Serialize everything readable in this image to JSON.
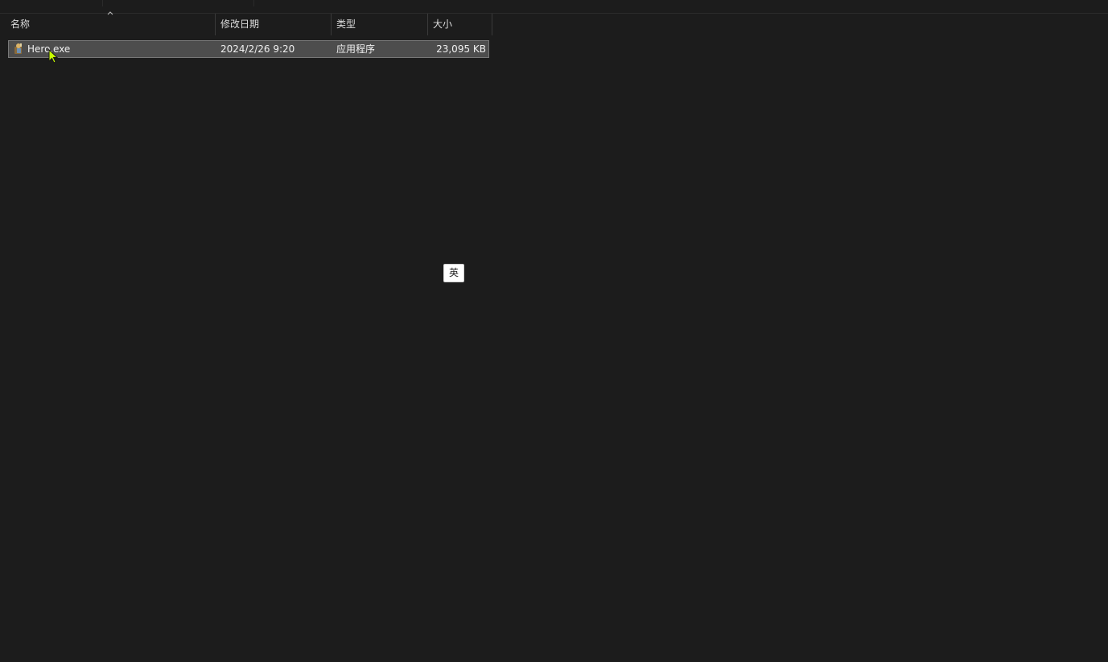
{
  "columns": {
    "name": "名称",
    "modified": "修改日期",
    "type": "类型",
    "size": "大小"
  },
  "sort": {
    "column": "name",
    "icon": "chevron-up-icon"
  },
  "files": [
    {
      "name": "Hero.exe",
      "modified": "2024/2/26 9:20",
      "type": "应用程序",
      "size": "23,095 KB",
      "icon": "application-icon",
      "selected": true
    }
  ],
  "ime_indicator": {
    "label": "英"
  },
  "colors": {
    "background": "#1c1c1c",
    "selection": "#4d4d4d",
    "selection_border": "#787878",
    "cursor": "#c8ff00"
  }
}
